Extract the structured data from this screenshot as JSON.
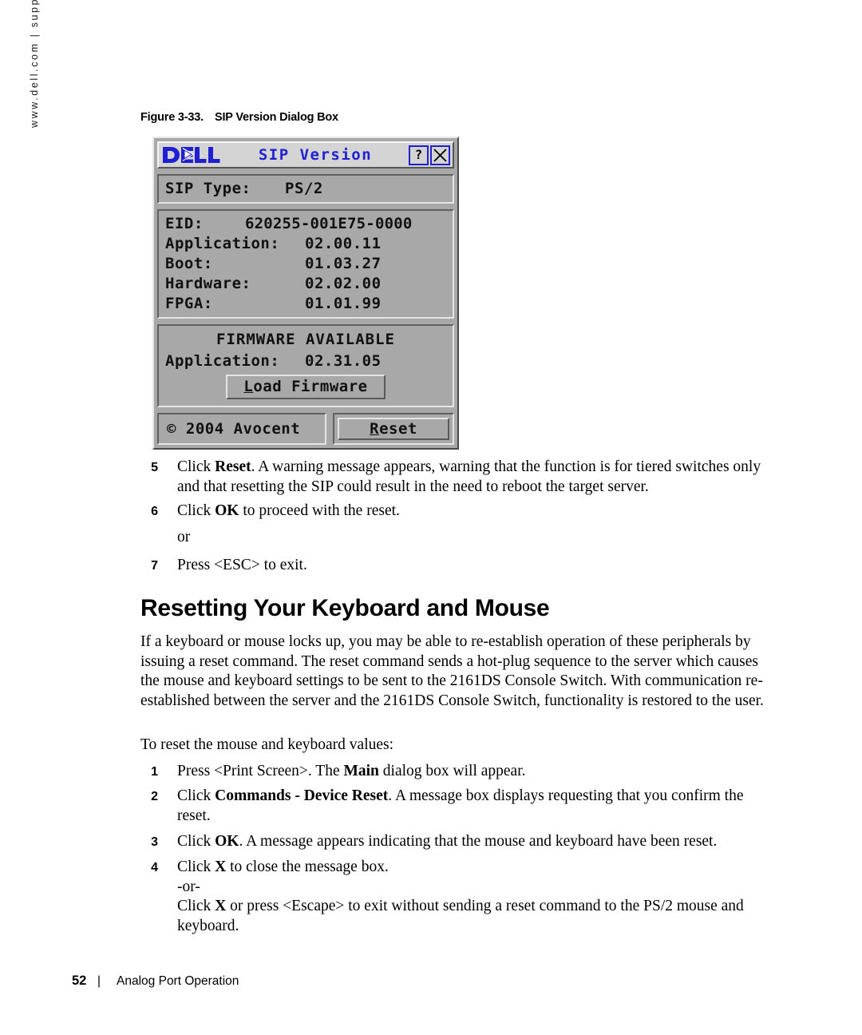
{
  "side_url": "www.dell.com | support.dell.com",
  "figure": {
    "number": "Figure 3-33.",
    "title": "SIP Version Dialog Box"
  },
  "dialog": {
    "logo": "dell-logo",
    "title": "SIP Version",
    "help_button": "?",
    "close_button": "X",
    "sip_type": {
      "label": "SIP Type:",
      "value": "PS/2"
    },
    "version_rows": [
      {
        "label": "EID:",
        "value": "620255-001E75-0000"
      },
      {
        "label": "Application:",
        "value": "02.00.11"
      },
      {
        "label": "Boot:",
        "value": "01.03.27"
      },
      {
        "label": "Hardware:",
        "value": "02.02.00"
      },
      {
        "label": "FPGA:",
        "value": "01.01.99"
      }
    ],
    "firmware": {
      "heading": "FIRMWARE AVAILABLE",
      "app_label": "Application:",
      "app_value": "02.31.05",
      "load_button": {
        "accel": "L",
        "rest": "oad Firmware"
      }
    },
    "copyright": "© 2004 Avocent",
    "reset_button": {
      "accel": "R",
      "rest": "eset"
    }
  },
  "steps_upper": [
    {
      "num": "5",
      "html": "Click <b>Reset</b>. A warning message appears, warning that the function is for tiered switches only and that resetting the SIP could result in the need to reboot the target server."
    },
    {
      "num": "6",
      "html": "Click <b>OK</b> to proceed with the reset."
    },
    {
      "num": "",
      "html": "or"
    },
    {
      "num": "7",
      "html": "Press &lt;ESC&gt; to exit."
    }
  ],
  "section_heading": "Resetting Your Keyboard and Mouse",
  "intro_paragraph": "If a keyboard or mouse locks up, you may be able to re-establish operation of these peripherals by issuing a reset command. The reset command sends a hot-plug sequence to the server which causes the mouse and keyboard settings to be sent to the 2161DS Console Switch. With communication re-established between the server and the 2161DS Console Switch, functionality is restored to the user.",
  "lead_in": "To reset the mouse and keyboard values:",
  "steps_lower": [
    {
      "num": "1",
      "html": "Press &lt;Print Screen&gt;. The <b>Main</b> dialog box will appear."
    },
    {
      "num": "2",
      "html": "Click <b>Commands - Device Reset</b>. A message box displays requesting that you confirm the reset."
    },
    {
      "num": "3",
      "html": "Click <b>OK</b>. A message appears indicating that the mouse and keyboard have been reset."
    },
    {
      "num": "4",
      "html": "Click <b>X</b> to close the message box.<br>-or-<br>Click <b>X</b> or press &lt;Escape&gt; to exit without sending a reset command to the PS/2 mouse and keyboard."
    }
  ],
  "footer": {
    "page_number": "52",
    "separator": "|",
    "chapter": "Analog Port Operation"
  },
  "colors": {
    "dell_blue": "#2020d0",
    "osd_face": "#a8a8a8",
    "titlebar": "#d4d4d4"
  }
}
